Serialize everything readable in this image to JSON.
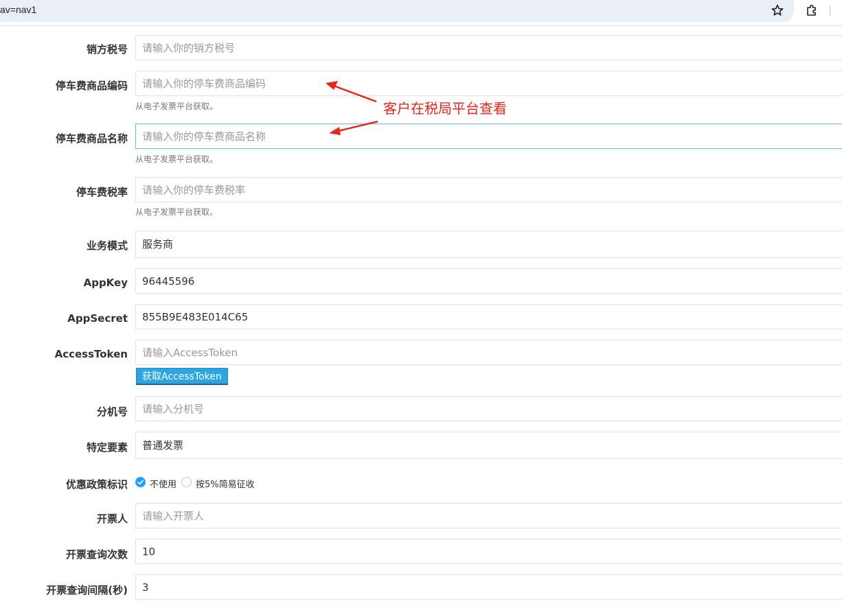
{
  "browser": {
    "url_fragment": "av=nav1",
    "icons": [
      "star-icon",
      "extension-icon"
    ]
  },
  "form": {
    "seller_tax_id": {
      "label": "销方税号",
      "placeholder": "请输入你的销方税号",
      "value": ""
    },
    "product_code": {
      "label": "停车费商品编码",
      "placeholder": "请输入你的停车费商品编码",
      "value": "",
      "hint": "从电子发票平台获取。"
    },
    "product_name": {
      "label": "停车费商品名称",
      "placeholder": "请输入你的停车费商品名称",
      "value": "",
      "hint": "从电子发票平台获取。"
    },
    "tax_rate": {
      "label": "停车费税率",
      "placeholder": "请输入你的停车费税率",
      "value": "",
      "hint": "从电子发票平台获取。"
    },
    "business_mode": {
      "label": "业务模式",
      "value": "服务商"
    },
    "app_key": {
      "label": "AppKey",
      "value": "96445596"
    },
    "app_secret": {
      "label": "AppSecret",
      "value": "855B9E483E014C65"
    },
    "access_token": {
      "label": "AccessToken",
      "placeholder": "请输入AccessToken",
      "value": "",
      "button": "获取AccessToken"
    },
    "extension_no": {
      "label": "分机号",
      "placeholder": "请输入分机号",
      "value": ""
    },
    "special_element": {
      "label": "特定要素",
      "value": "普通发票"
    },
    "preferential_policy": {
      "label": "优惠政策标识",
      "options": [
        {
          "label": "不使用",
          "checked": true
        },
        {
          "label": "按5%简易征收",
          "checked": false
        }
      ]
    },
    "issuer": {
      "label": "开票人",
      "placeholder": "请输入开票人",
      "value": ""
    },
    "query_count": {
      "label": "开票查询次数",
      "value": "10"
    },
    "query_interval": {
      "label": "开票查询间隔(秒)",
      "value": "3"
    }
  },
  "annotation": {
    "text": "客户在税局平台查看",
    "color": "#e8251b"
  },
  "colors": {
    "accent": "#2ba6e1",
    "radio_checked": "#1e9fff",
    "focus_border": "#5fb8e5"
  }
}
